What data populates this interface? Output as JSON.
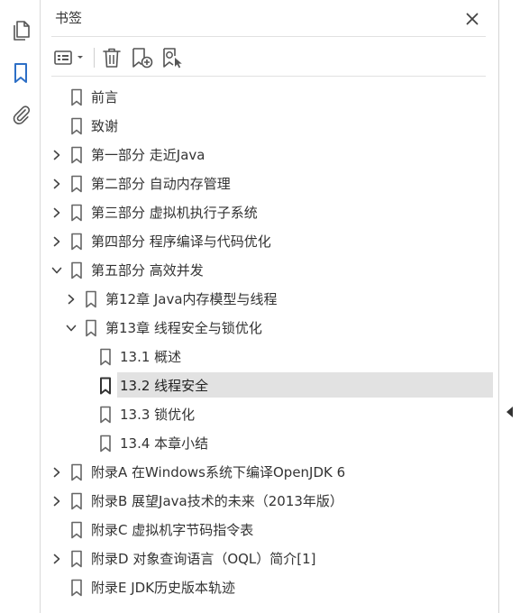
{
  "panel": {
    "title": "书签"
  },
  "colors": {
    "accent": "#2d6fc6",
    "icon": "#555555",
    "selected_bg": "#e2e2e2",
    "text": "#333333"
  },
  "rail": {
    "items": [
      {
        "name": "pages-icon",
        "active": false
      },
      {
        "name": "bookmark-icon",
        "active": true
      },
      {
        "name": "paperclip-icon",
        "active": false
      }
    ]
  },
  "toolbar": {
    "items": [
      "options-menu-icon",
      "delete-icon",
      "add-bookmark-icon",
      "find-bookmark-icon"
    ]
  },
  "bookmarks": [
    {
      "label": "前言",
      "level": 0,
      "expander": "none"
    },
    {
      "label": "致谢",
      "level": 0,
      "expander": "none"
    },
    {
      "label": "第一部分 走近Java",
      "level": 0,
      "expander": "collapsed"
    },
    {
      "label": "第二部分 自动内存管理",
      "level": 0,
      "expander": "collapsed"
    },
    {
      "label": "第三部分 虚拟机执行子系统",
      "level": 0,
      "expander": "collapsed"
    },
    {
      "label": "第四部分 程序编译与代码优化",
      "level": 0,
      "expander": "collapsed"
    },
    {
      "label": "第五部分 高效并发",
      "level": 0,
      "expander": "expanded"
    },
    {
      "label": "第12章 Java内存模型与线程",
      "level": 1,
      "expander": "collapsed"
    },
    {
      "label": "第13章 线程安全与锁优化",
      "level": 1,
      "expander": "expanded"
    },
    {
      "label": "13.1 概述",
      "level": 2,
      "expander": "none"
    },
    {
      "label": "13.2 线程安全",
      "level": 2,
      "expander": "none",
      "selected": true
    },
    {
      "label": "13.3 锁优化",
      "level": 2,
      "expander": "none"
    },
    {
      "label": "13.4 本章小结",
      "level": 2,
      "expander": "none"
    },
    {
      "label": "附录A 在Windows系统下编译OpenJDK 6",
      "level": 0,
      "expander": "collapsed"
    },
    {
      "label": "附录B 展望Java技术的未来（2013年版）",
      "level": 0,
      "expander": "collapsed"
    },
    {
      "label": "附录C 虚拟机字节码指令表",
      "level": 0,
      "expander": "none"
    },
    {
      "label": "附录D 对象查询语言（OQL）简介[1]",
      "level": 0,
      "expander": "collapsed"
    },
    {
      "label": "附录E JDK历史版本轨迹",
      "level": 0,
      "expander": "none"
    }
  ]
}
